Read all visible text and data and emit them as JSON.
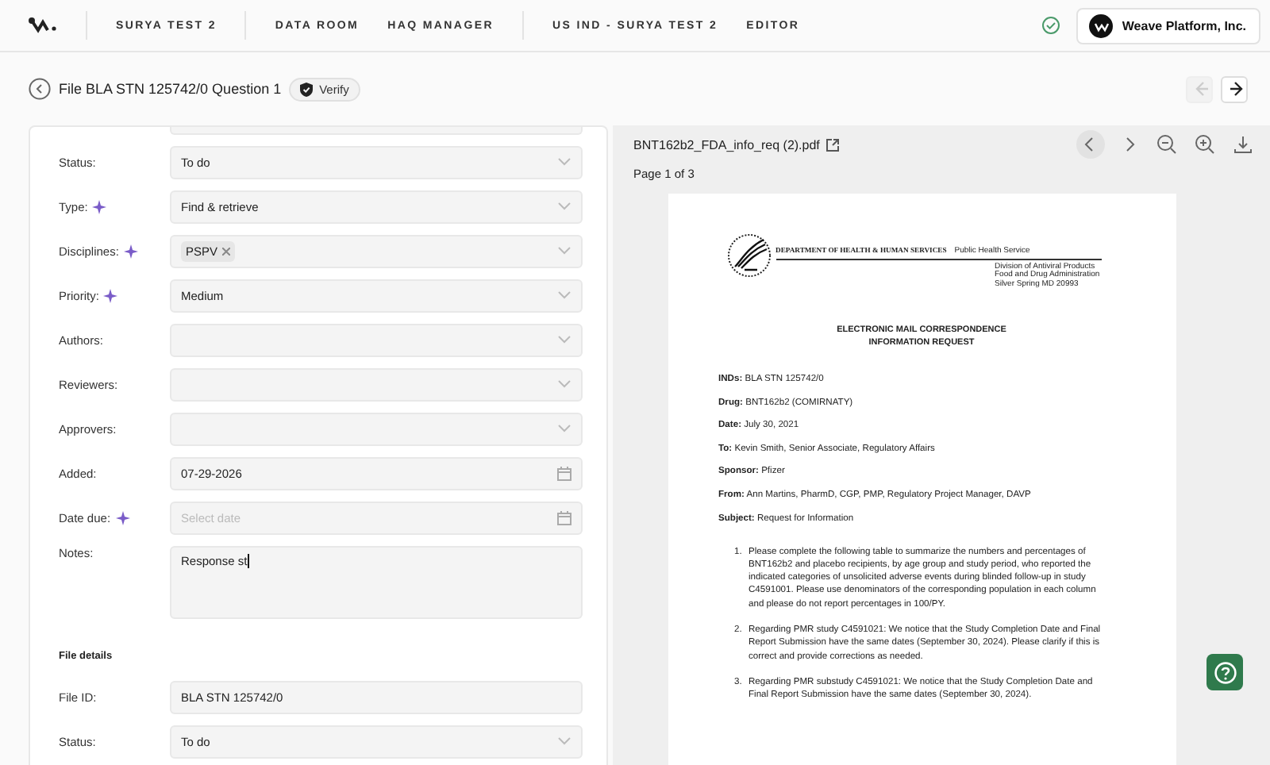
{
  "nav": {
    "project": "SURYA TEST 2",
    "links": [
      {
        "label": "DATA ROOM",
        "selected": false
      },
      {
        "label": "HAQ MANAGER",
        "selected": false
      }
    ],
    "context": [
      "US IND - SURYA TEST 2",
      "EDITOR"
    ],
    "synced": true,
    "org": "Weave Platform, Inc."
  },
  "page": {
    "title": "File BLA STN 125742/0 Question 1",
    "badge": "Verify",
    "prev_disabled": true,
    "next_disabled": false
  },
  "form": {
    "fields": [
      {
        "kind": "partial"
      },
      {
        "kind": "select",
        "label": "Status:",
        "value": "To do",
        "ai": false
      },
      {
        "kind": "select",
        "label": "Type:",
        "value": "Find & retrieve",
        "ai": true
      },
      {
        "kind": "tags",
        "label": "Disciplines:",
        "tags": [
          "PSPV"
        ],
        "ai": true
      },
      {
        "kind": "select",
        "label": "Priority:",
        "value": "Medium",
        "ai": true
      },
      {
        "kind": "select",
        "label": "Authors:",
        "ai": false
      },
      {
        "kind": "select",
        "label": "Reviewers:",
        "ai": false
      },
      {
        "kind": "select",
        "label": "Approvers:",
        "ai": false
      },
      {
        "kind": "date",
        "label": "Added:",
        "value": "07-29-2026",
        "ai": false
      },
      {
        "kind": "date",
        "label": "Date due:",
        "placeholder": "Select date",
        "ai": true
      },
      {
        "kind": "textarea",
        "label": "Notes:",
        "value": "Response st",
        "ai": false
      },
      {
        "kind": "section",
        "label": "File details"
      },
      {
        "kind": "text",
        "label": "File ID:",
        "value": "BLA STN 125742/0",
        "ai": false
      },
      {
        "kind": "select",
        "label": "Status:",
        "value": "To do",
        "ai": false
      }
    ]
  },
  "viewer": {
    "file": "BNT162b2_FDA_info_req (2).pdf",
    "page_label": "Page 1 of 3",
    "doc": {
      "agency": "DEPARTMENT OF HEALTH & HUMAN SERVICES",
      "service": "Public Health Service",
      "division": [
        "Division of Antiviral Products",
        "Food and Drug Administration",
        "Silver Spring MD 20993"
      ],
      "heading": [
        "ELECTRONIC MAIL CORRESPONDENCE",
        "INFORMATION REQUEST"
      ],
      "meta": [
        {
          "key": "INDs:",
          "value": "BLA STN 125742/0"
        },
        {
          "key": "Drug:",
          "value": "BNT162b2 (COMIRNATY)"
        },
        {
          "key": "Date:",
          "value": "July 30, 2021"
        },
        {
          "key": "To:",
          "value": "Kevin Smith, Senior Associate, Regulatory Affairs"
        },
        {
          "key": "Sponsor:",
          "value": "Pfizer"
        },
        {
          "key": "From:",
          "value": "Ann Martins, PharmD, CGP, PMP, Regulatory Project Manager, DAVP"
        },
        {
          "key": "Subject:",
          "value": "Request for Information"
        }
      ],
      "items": [
        {
          "number": "1.",
          "text": "Please complete the following table to summarize the numbers and percentages of BNT162b2 and placebo recipients, by age group and study period, who reported the indicated categories of unsolicited adverse events during blinded follow-up in study C4591001. Please use denominators of the corresponding population in each column and please do not report percentages in 100/PY."
        },
        {
          "number": "2.",
          "text": "Regarding PMR study C4591021: We notice that the Study Completion Date and Final Report Submission have the same dates (September 30, 2024). Please clarify if this is correct and provide corrections as needed."
        },
        {
          "number": "3.",
          "text": "Regarding PMR substudy C4591021: We notice that the Study Completion Date and Final Report Submission have the same dates (September 30, 2024)."
        }
      ]
    }
  }
}
